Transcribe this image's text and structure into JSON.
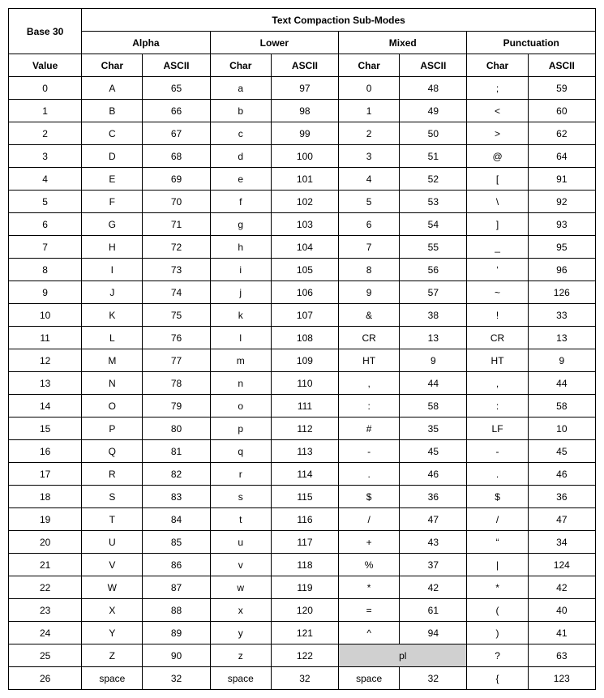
{
  "header": {
    "title": "Text Compaction Sub-Modes",
    "base30_line1": "Base 30",
    "base30_line2": "Value",
    "groups": [
      "Alpha",
      "Lower",
      "Mixed",
      "Punctuation"
    ],
    "char_label": "Char",
    "ascii_label": "ASCII"
  },
  "rows": [
    {
      "v": "0",
      "a_ch": "A",
      "a_as": "65",
      "l_ch": "a",
      "l_as": "97",
      "m_ch": "0",
      "m_as": "48",
      "p_ch": ";",
      "p_as": "59"
    },
    {
      "v": "1",
      "a_ch": "B",
      "a_as": "66",
      "l_ch": "b",
      "l_as": "98",
      "m_ch": "1",
      "m_as": "49",
      "p_ch": "<",
      "p_as": "60"
    },
    {
      "v": "2",
      "a_ch": "C",
      "a_as": "67",
      "l_ch": "c",
      "l_as": "99",
      "m_ch": "2",
      "m_as": "50",
      "p_ch": ">",
      "p_as": "62"
    },
    {
      "v": "3",
      "a_ch": "D",
      "a_as": "68",
      "l_ch": "d",
      "l_as": "100",
      "m_ch": "3",
      "m_as": "51",
      "p_ch": "@",
      "p_as": "64"
    },
    {
      "v": "4",
      "a_ch": "E",
      "a_as": "69",
      "l_ch": "e",
      "l_as": "101",
      "m_ch": "4",
      "m_as": "52",
      "p_ch": "[",
      "p_as": "91"
    },
    {
      "v": "5",
      "a_ch": "F",
      "a_as": "70",
      "l_ch": "f",
      "l_as": "102",
      "m_ch": "5",
      "m_as": "53",
      "p_ch": "\\",
      "p_as": "92"
    },
    {
      "v": "6",
      "a_ch": "G",
      "a_as": "71",
      "l_ch": "g",
      "l_as": "103",
      "m_ch": "6",
      "m_as": "54",
      "p_ch": "]",
      "p_as": "93"
    },
    {
      "v": "7",
      "a_ch": "H",
      "a_as": "72",
      "l_ch": "h",
      "l_as": "104",
      "m_ch": "7",
      "m_as": "55",
      "p_ch": "_",
      "p_as": "95"
    },
    {
      "v": "8",
      "a_ch": "I",
      "a_as": "73",
      "l_ch": "i",
      "l_as": "105",
      "m_ch": "8",
      "m_as": "56",
      "p_ch": "‘",
      "p_as": "96"
    },
    {
      "v": "9",
      "a_ch": "J",
      "a_as": "74",
      "l_ch": "j",
      "l_as": "106",
      "m_ch": "9",
      "m_as": "57",
      "p_ch": "~",
      "p_as": "126"
    },
    {
      "v": "10",
      "a_ch": "K",
      "a_as": "75",
      "l_ch": "k",
      "l_as": "107",
      "m_ch": "&",
      "m_as": "38",
      "p_ch": "!",
      "p_as": "33"
    },
    {
      "v": "11",
      "a_ch": "L",
      "a_as": "76",
      "l_ch": "l",
      "l_as": "108",
      "m_ch": "CR",
      "m_as": "13",
      "p_ch": "CR",
      "p_as": "13"
    },
    {
      "v": "12",
      "a_ch": "M",
      "a_as": "77",
      "l_ch": "m",
      "l_as": "109",
      "m_ch": "HT",
      "m_as": "9",
      "p_ch": "HT",
      "p_as": "9"
    },
    {
      "v": "13",
      "a_ch": "N",
      "a_as": "78",
      "l_ch": "n",
      "l_as": "110",
      "m_ch": ",",
      "m_as": "44",
      "p_ch": ",",
      "p_as": "44"
    },
    {
      "v": "14",
      "a_ch": "O",
      "a_as": "79",
      "l_ch": "o",
      "l_as": "111",
      "m_ch": ":",
      "m_as": "58",
      "p_ch": ":",
      "p_as": "58"
    },
    {
      "v": "15",
      "a_ch": "P",
      "a_as": "80",
      "l_ch": "p",
      "l_as": "112",
      "m_ch": "#",
      "m_as": "35",
      "p_ch": "LF",
      "p_as": "10"
    },
    {
      "v": "16",
      "a_ch": "Q",
      "a_as": "81",
      "l_ch": "q",
      "l_as": "113",
      "m_ch": "-",
      "m_as": "45",
      "p_ch": "-",
      "p_as": "45"
    },
    {
      "v": "17",
      "a_ch": "R",
      "a_as": "82",
      "l_ch": "r",
      "l_as": "114",
      "m_ch": ".",
      "m_as": "46",
      "p_ch": ".",
      "p_as": "46"
    },
    {
      "v": "18",
      "a_ch": "S",
      "a_as": "83",
      "l_ch": "s",
      "l_as": "115",
      "m_ch": "$",
      "m_as": "36",
      "p_ch": "$",
      "p_as": "36"
    },
    {
      "v": "19",
      "a_ch": "T",
      "a_as": "84",
      "l_ch": "t",
      "l_as": "116",
      "m_ch": "/",
      "m_as": "47",
      "p_ch": "/",
      "p_as": "47"
    },
    {
      "v": "20",
      "a_ch": "U",
      "a_as": "85",
      "l_ch": "u",
      "l_as": "117",
      "m_ch": "+",
      "m_as": "43",
      "p_ch": "“",
      "p_as": "34"
    },
    {
      "v": "21",
      "a_ch": "V",
      "a_as": "86",
      "l_ch": "v",
      "l_as": "118",
      "m_ch": "%",
      "m_as": "37",
      "p_ch": "|",
      "p_as": "124"
    },
    {
      "v": "22",
      "a_ch": "W",
      "a_as": "87",
      "l_ch": "w",
      "l_as": "119",
      "m_ch": "*",
      "m_as": "42",
      "p_ch": "*",
      "p_as": "42"
    },
    {
      "v": "23",
      "a_ch": "X",
      "a_as": "88",
      "l_ch": "x",
      "l_as": "120",
      "m_ch": "=",
      "m_as": "61",
      "p_ch": "(",
      "p_as": "40"
    },
    {
      "v": "24",
      "a_ch": "Y",
      "a_as": "89",
      "l_ch": "y",
      "l_as": "121",
      "m_ch": "^",
      "m_as": "94",
      "p_ch": ")",
      "p_as": "41"
    },
    {
      "v": "25",
      "a_ch": "Z",
      "a_as": "90",
      "l_ch": "z",
      "l_as": "122",
      "m_span": "pl",
      "m_shaded": true,
      "p_ch": "?",
      "p_as": "63"
    },
    {
      "v": "26",
      "a_ch": "space",
      "a_as": "32",
      "l_ch": "space",
      "l_as": "32",
      "m_ch": "space",
      "m_as": "32",
      "p_ch": "{",
      "p_as": "123"
    }
  ]
}
